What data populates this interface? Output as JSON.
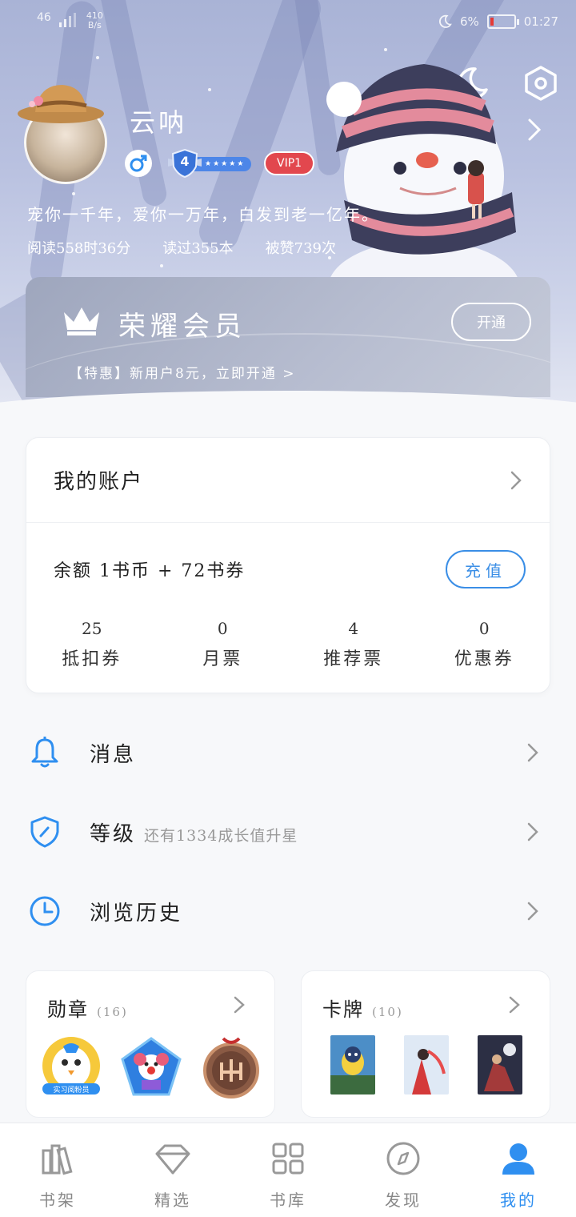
{
  "status_bar": {
    "signal": "46",
    "net_speed": "410",
    "net_unit": "B/s",
    "battery_pct": "6%",
    "time": "01:27"
  },
  "profile": {
    "username": "云呐",
    "level": "4",
    "vip": "VIP1",
    "motto": "宠你一千年，爱你一万年，白发到老一亿年。",
    "read_time": "阅读558时36分",
    "books_read": "读过355本",
    "likes": "被赞739次"
  },
  "vip_card": {
    "title": "荣耀会员",
    "open_button": "开通",
    "promo": "【特惠】新用户8元，立即开通 >"
  },
  "account": {
    "title": "我的账户",
    "balance": "余额  1书币 + 72书券",
    "recharge_button": "充值",
    "tickets": [
      {
        "value": "25",
        "label": "抵扣券"
      },
      {
        "value": "0",
        "label": "月票"
      },
      {
        "value": "4",
        "label": "推荐票"
      },
      {
        "value": "0",
        "label": "优惠券"
      }
    ]
  },
  "menu": {
    "messages": "消息",
    "level": "等级",
    "level_hint": "还有1334成长值升星",
    "history": "浏览历史"
  },
  "medals": {
    "title": "勋章",
    "count": "(16)",
    "medal_text": "实习阅粉员"
  },
  "cards": {
    "title": "卡牌",
    "count": "(10)"
  },
  "tabs": [
    {
      "label": "书架",
      "icon": "bookshelf-icon"
    },
    {
      "label": "精选",
      "icon": "diamond-icon"
    },
    {
      "label": "书库",
      "icon": "grid-icon"
    },
    {
      "label": "发现",
      "icon": "compass-icon"
    },
    {
      "label": "我的",
      "icon": "user-icon"
    }
  ],
  "colors": {
    "accent": "#2f8ff0",
    "vip_red": "#e2474e",
    "hero_bg": "#b9c1e0"
  }
}
